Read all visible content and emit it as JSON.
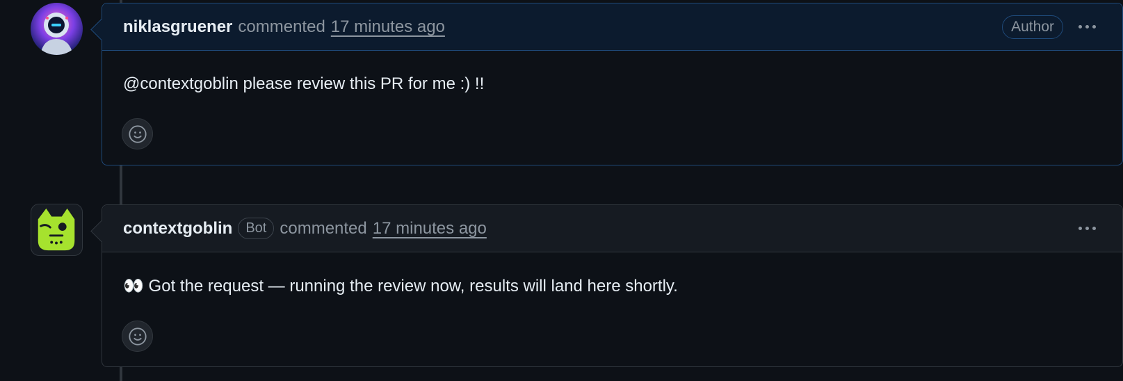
{
  "comments": [
    {
      "username": "niklasgruener",
      "action": "commented",
      "timestamp": "17 minutes ago",
      "badge": "Author",
      "body": "@contextgoblin please review this PR for me :) !!",
      "avatar_icon": "astronaut-avatar-icon"
    },
    {
      "username": "contextgoblin",
      "bot_label": "Bot",
      "action": "commented",
      "timestamp": "17 minutes ago",
      "body": "👀 Got the request — running the review now, results will land here shortly.",
      "avatar_icon": "goblin-avatar-icon"
    }
  ],
  "colors": {
    "background": "#0d1117",
    "author_border": "#1f4a7a",
    "goblin_green": "#a6e22e"
  }
}
